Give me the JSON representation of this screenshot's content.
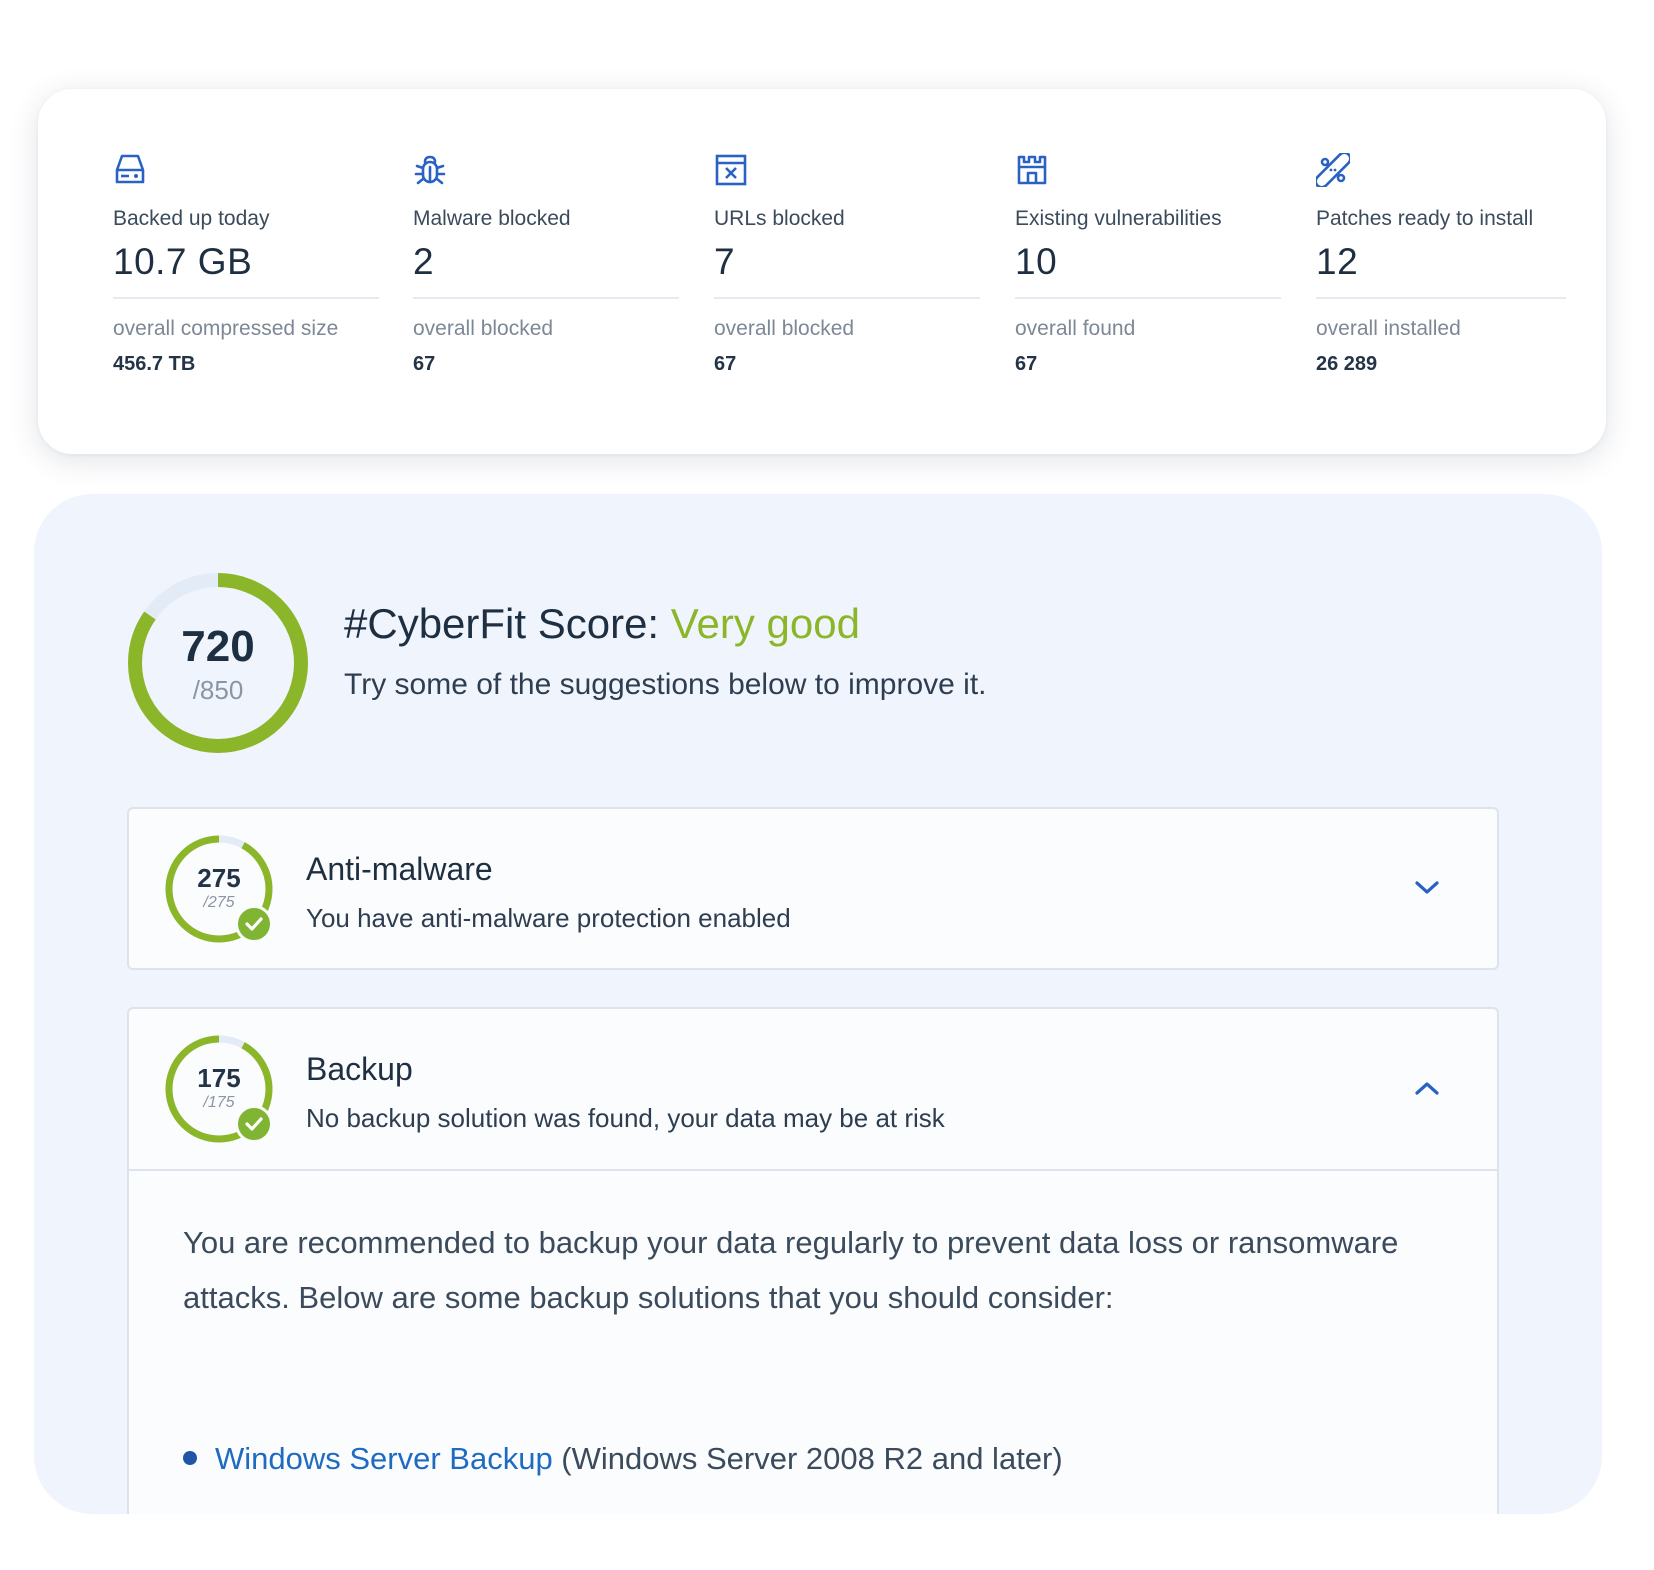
{
  "stats": [
    {
      "icon": "hard-drive-icon",
      "label": "Backed up today",
      "value": "10.7 GB",
      "sub_label": "overall compressed size",
      "sub_value": "456.7 TB"
    },
    {
      "icon": "bug-icon",
      "label": "Malware blocked",
      "value": "2",
      "sub_label": "overall blocked",
      "sub_value": "67"
    },
    {
      "icon": "blocked-url-icon",
      "label": "URLs blocked",
      "value": "7",
      "sub_label": "overall blocked",
      "sub_value": "67"
    },
    {
      "icon": "castle-icon",
      "label": "Existing vulnerabilities",
      "value": "10",
      "sub_label": "overall found",
      "sub_value": "67"
    },
    {
      "icon": "patch-icon",
      "label": "Patches ready to install",
      "value": "12",
      "sub_label": "overall installed",
      "sub_value": "26 289"
    }
  ],
  "score": {
    "value": "720",
    "total": "/850",
    "fraction": 0.847,
    "title_prefix": "#CyberFit Score: ",
    "rating": "Very good",
    "subtitle": "Try some of the suggestions below to improve it."
  },
  "items": [
    {
      "score": "275",
      "total": "/275",
      "fraction": 0.92,
      "title": "Anti-malware",
      "description": "You have anti-malware protection enabled",
      "expanded": false
    },
    {
      "score": "175",
      "total": "/175",
      "fraction": 0.92,
      "title": "Backup",
      "description": "No backup solution was found, your data may be at risk",
      "expanded": true,
      "body": "You are recommended to backup your data regularly to prevent data loss or ransomware attacks. Below are some backup solutions that you should consider:",
      "solutions": [
        {
          "link": "Windows Server Backup",
          "note": " (Windows Server 2008 R2 and later)"
        }
      ]
    }
  ],
  "colors": {
    "accent_green": "#8bb62a",
    "gauge_track": "#e3ebf6",
    "icon_blue": "#2a62c4",
    "link_blue": "#1f6bc2"
  }
}
